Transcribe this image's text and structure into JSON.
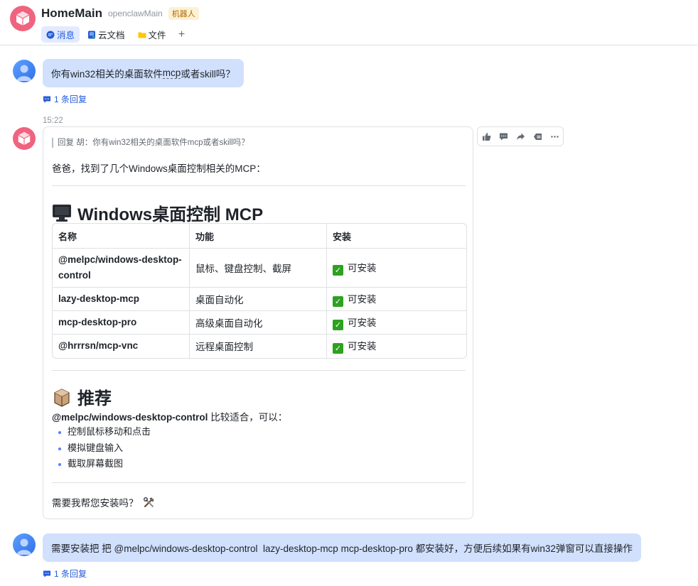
{
  "header": {
    "title": "HomeMain",
    "subtitle": "openclawMain",
    "badge": "机器人",
    "avatar_icon": "cube-icon",
    "tabs": [
      {
        "label": "消息",
        "icon": "chat-icon",
        "active": true
      },
      {
        "label": "云文档",
        "icon": "doc-icon",
        "active": false
      },
      {
        "label": "文件",
        "icon": "folder-icon",
        "active": false
      }
    ],
    "add_tab": "+"
  },
  "colors": {
    "accent": "#245bdb",
    "user_bubble": "#d1e0fd",
    "bot_avatar": "#f0637f",
    "check_green": "#2ea121",
    "badge_bg": "#fdf1d5"
  },
  "messages": {
    "m1": {
      "text_before": "你有win32相关的桌面软件",
      "text_mcp": "mcp",
      "text_after": "或者skill吗？",
      "reply": "1 条回复"
    },
    "time": "15:22",
    "bot": {
      "quote": "回复 胡：你有win32相关的桌面软件mcp或者skill吗？",
      "intro": "爸爸，找到了几个Windows桌面控制相关的MCP：",
      "heading1": "Windows桌面控制 MCP",
      "heading1_icon": "computer-icon",
      "table": {
        "headers": [
          "名称",
          "功能",
          "安装"
        ],
        "rows": [
          {
            "name": "@melpc/windows-desktop-control",
            "func": "鼠标、键盘控制、截屏",
            "install": "可安装"
          },
          {
            "name": "lazy-desktop-mcp",
            "func": "桌面自动化",
            "install": "可安装"
          },
          {
            "name": "mcp-desktop-pro",
            "func": "高级桌面自动化",
            "install": "可安装"
          },
          {
            "name": "@hrrrsn/mcp-vnc",
            "func": "远程桌面控制",
            "install": "可安装"
          }
        ]
      },
      "heading2": "推荐",
      "heading2_icon": "package-icon",
      "rec_name": "@melpc/windows-desktop-control",
      "rec_rest": " 比较适合，可以：",
      "bullets": [
        "控制鼠标移动和点击",
        "模拟键盘输入",
        "截取屏幕截图"
      ],
      "closing": "需要我帮您安装吗？",
      "closing_icon": "tools-icon"
    },
    "m2": {
      "text": "需要安装把 把 @melpc/windows-desktop-control  lazy-desktop-mcp mcp-desktop-pro 都安装好，方便后续如果有win32弹窗可以直接操作",
      "reply": "1 条回复"
    }
  },
  "actions": [
    "thumbs-up-icon",
    "comment-icon",
    "forward-icon",
    "quote-icon",
    "more-icon"
  ]
}
